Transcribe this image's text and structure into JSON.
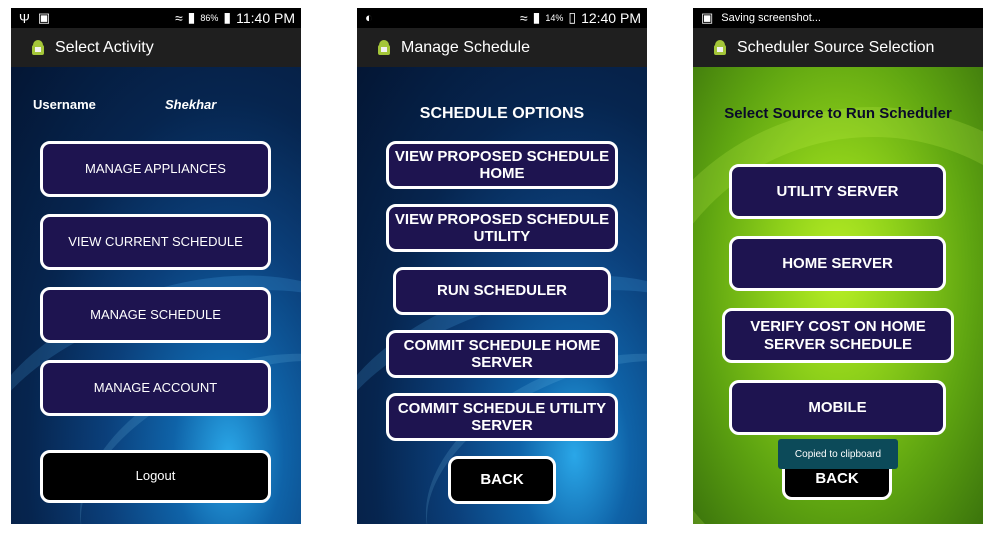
{
  "screen1": {
    "status_time": "11:40 PM",
    "status_battery": "86%",
    "title": "Select Activity",
    "username_label": "Username",
    "username_value": "Shekhar",
    "buttons": [
      "MANAGE APPLIANCES",
      "VIEW CURRENT SCHEDULE",
      "MANAGE SCHEDULE",
      "MANAGE ACCOUNT"
    ],
    "logout_label": "Logout"
  },
  "screen2": {
    "status_time": "12:40 PM",
    "status_battery": "14%",
    "title": "Manage Schedule",
    "heading": "SCHEDULE OPTIONS",
    "buttons": [
      {
        "line1": "VIEW PROPOSED SCHEDULE",
        "line2": "HOME"
      },
      {
        "line1": "VIEW PROPOSED SCHEDULE",
        "line2": "UTILITY"
      },
      {
        "line1": "RUN SCHEDULER",
        "line2": ""
      },
      {
        "line1": "COMMIT SCHEDULE HOME",
        "line2": "SERVER"
      },
      {
        "line1": "COMMIT SCHEDULE UTILITY",
        "line2": "SERVER"
      }
    ],
    "back_label": "BACK"
  },
  "screen3": {
    "status_text": "Saving screenshot...",
    "title": "Scheduler Source Selection",
    "heading": "Select Source to Run Scheduler",
    "buttons": [
      {
        "line1": "UTILITY SERVER",
        "line2": ""
      },
      {
        "line1": "HOME SERVER",
        "line2": ""
      },
      {
        "line1": "VERIFY COST  ON HOME",
        "line2": "SERVER SCHEDULE"
      },
      {
        "line1": "MOBILE",
        "line2": ""
      }
    ],
    "back_label": "BACK",
    "toast": "Copied to clipboard"
  }
}
